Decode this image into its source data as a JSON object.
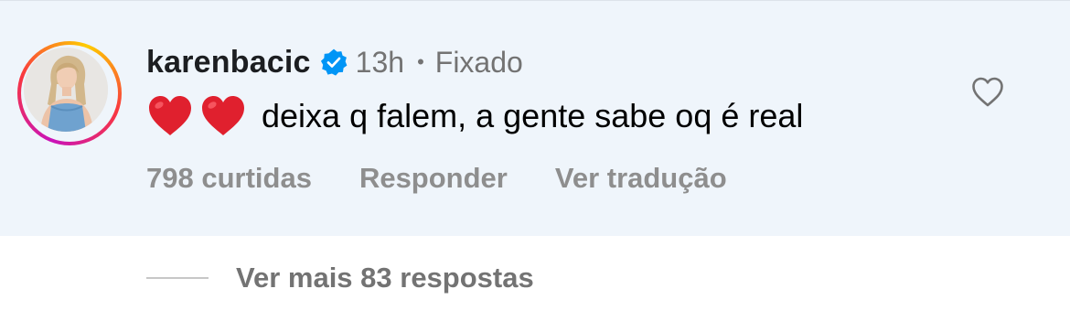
{
  "comment": {
    "username": "karenbacic",
    "verified": true,
    "time": "13h",
    "separator": "•",
    "pinned_label": "Fixado",
    "emojis": [
      "red-heart",
      "red-heart"
    ],
    "text": "deixa q falem, a gente sabe oq é real",
    "likes_label": "798 curtidas",
    "reply_label": "Responder",
    "translate_label": "Ver tradução"
  },
  "replies": {
    "more_label": "Ver mais 83 respostas"
  },
  "colors": {
    "highlight_bg": "#eff5fb",
    "secondary_text": "#737373",
    "verified_blue": "#0095f6",
    "heart_red": "#e0202e"
  },
  "icons": {
    "verified": "verified-badge-icon",
    "like": "heart-outline-icon",
    "emoji": "red-heart-emoji"
  }
}
